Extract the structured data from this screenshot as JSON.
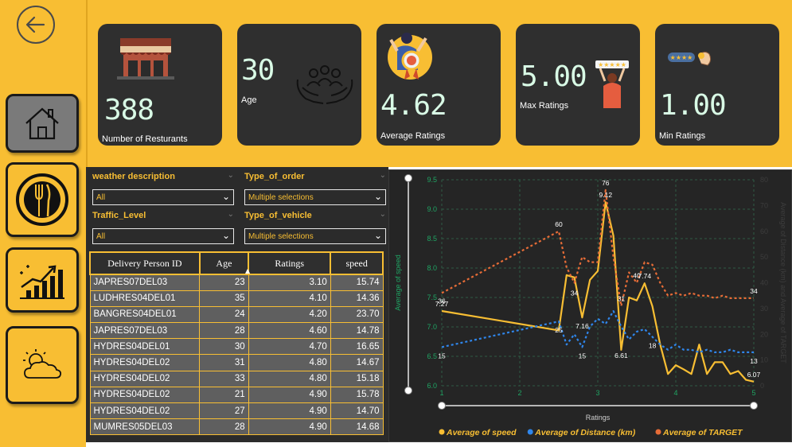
{
  "colors": {
    "accent": "#F8BE33",
    "card": "#2f2f2f",
    "speed": "#F8BE33",
    "distance": "#2F86EB",
    "target": "#E66C37"
  },
  "nav": {
    "icons": [
      "back-arrow-icon",
      "home-icon",
      "plate-fork-knife-icon",
      "growth-chart-icon",
      "weather-icon"
    ]
  },
  "kpis": {
    "restaurants": {
      "value": "388",
      "label": "Number of Resturants"
    },
    "age": {
      "value": "30",
      "label": "Age"
    },
    "avg_ratings": {
      "value": "4.62",
      "label": "Average Ratings"
    },
    "max_ratings": {
      "value": "5.00",
      "label": "Max Ratings"
    },
    "min_ratings": {
      "value": "1.00",
      "label": "Min Ratings"
    }
  },
  "filters": {
    "weather": {
      "title": "weather description",
      "value": "All"
    },
    "order": {
      "title": "Type_of_order",
      "value": "Multiple selections"
    },
    "traffic": {
      "title": "Traffic_Level",
      "value": "All"
    },
    "vehicle": {
      "title": "Type_of_vehicle",
      "value": "Multiple selections"
    }
  },
  "table": {
    "columns": [
      "Delivery Person ID",
      "Age",
      "Ratings",
      "speed"
    ],
    "rows": [
      [
        "JAPRES07DEL03",
        "23",
        "3.10",
        "15.74"
      ],
      [
        "LUDHRES04DEL01",
        "35",
        "4.10",
        "14.36"
      ],
      [
        "BANGRES04DEL01",
        "24",
        "4.20",
        "23.70"
      ],
      [
        "JAPRES07DEL03",
        "28",
        "4.60",
        "14.78"
      ],
      [
        "HYDRES04DEL01",
        "30",
        "4.70",
        "16.65"
      ],
      [
        "HYDRES04DEL02",
        "31",
        "4.80",
        "14.67"
      ],
      [
        "HYDRES04DEL02",
        "33",
        "4.80",
        "15.18"
      ],
      [
        "HYDRES04DEL02",
        "21",
        "4.90",
        "15.78"
      ],
      [
        "HYDRES04DEL02",
        "27",
        "4.90",
        "14.70"
      ],
      [
        "MUMRES05DEL03",
        "28",
        "4.90",
        "14.68"
      ]
    ]
  },
  "chart_data": {
    "type": "line",
    "xlabel": "Ratings",
    "ylabel": "Average of speed",
    "y2label": "Average of Distance (km) and Average of TARGET",
    "xlim": [
      1,
      5
    ],
    "ylim": [
      6.0,
      9.5
    ],
    "y2lim": [
      0,
      80
    ],
    "xticks": [
      "1",
      "2",
      "3",
      "4",
      "5"
    ],
    "yticks": [
      "6.0",
      "6.5",
      "7.0",
      "7.5",
      "8.0",
      "8.5",
      "9.0",
      "9.5"
    ],
    "y2ticks": [
      "0",
      "10",
      "20",
      "30",
      "40",
      "50",
      "60",
      "70",
      "80"
    ],
    "legend_position": "bottom",
    "series": [
      {
        "name": "Average of speed",
        "axis": "left",
        "style": "solid",
        "x": [
          1.0,
          2.5,
          2.6,
          2.7,
          2.8,
          2.9,
          3.0,
          3.1,
          3.2,
          3.3,
          3.4,
          3.5,
          3.6,
          3.7,
          3.8,
          3.9,
          4.0,
          4.1,
          4.2,
          4.3,
          4.4,
          4.5,
          4.6,
          4.7,
          4.8,
          4.9,
          5.0
        ],
        "y": [
          7.27,
          6.94,
          7.88,
          7.84,
          7.16,
          7.8,
          7.95,
          9.12,
          8.55,
          6.61,
          7.5,
          7.45,
          7.74,
          7.35,
          6.7,
          6.2,
          6.35,
          6.28,
          6.2,
          6.7,
          6.2,
          6.4,
          6.4,
          6.2,
          6.25,
          6.1,
          6.07
        ]
      },
      {
        "name": "Average of Distance (km)",
        "axis": "right",
        "style": "dotted",
        "x": [
          1.0,
          2.5,
          2.6,
          2.7,
          2.8,
          2.9,
          3.0,
          3.1,
          3.2,
          3.3,
          3.4,
          3.5,
          3.6,
          3.7,
          3.8,
          3.9,
          4.0,
          4.1,
          4.2,
          4.3,
          4.4,
          4.5,
          4.6,
          4.7,
          4.8,
          4.9,
          5.0
        ],
        "y": [
          15,
          25,
          16,
          20,
          15,
          23,
          26,
          24,
          29,
          23,
          18,
          21,
          22,
          19,
          16,
          14,
          16,
          14,
          14,
          13,
          14,
          13,
          13,
          14,
          13,
          13,
          13
        ]
      },
      {
        "name": "Average of TARGET",
        "axis": "right",
        "style": "dotted",
        "x": [
          1.0,
          2.5,
          2.6,
          2.7,
          2.8,
          2.9,
          3.0,
          3.1,
          3.2,
          3.3,
          3.4,
          3.5,
          3.6,
          3.7,
          3.8,
          3.9,
          4.0,
          4.1,
          4.2,
          4.3,
          4.4,
          4.5,
          4.6,
          4.7,
          4.8,
          4.9,
          5.0
        ],
        "y": [
          36,
          60,
          46,
          40,
          50,
          48,
          48,
          76,
          50,
          31,
          44,
          40,
          48,
          47,
          40,
          35,
          36,
          35,
          36,
          35,
          35,
          34,
          35,
          34,
          34,
          34,
          34
        ]
      }
    ],
    "data_labels": [
      {
        "series": 0,
        "index": 0,
        "text": "7.27"
      },
      {
        "series": 0,
        "index": 7,
        "text": "9.12"
      },
      {
        "series": 0,
        "index": 4,
        "text": "7.16"
      },
      {
        "series": 0,
        "index": 12,
        "text": "7.74"
      },
      {
        "series": 0,
        "index": 9,
        "text": "6.61"
      },
      {
        "series": 0,
        "index": 26,
        "text": "6.07"
      },
      {
        "series": 1,
        "index": 0,
        "text": "15"
      },
      {
        "series": 1,
        "index": 1,
        "text": "25"
      },
      {
        "series": 1,
        "index": 4,
        "text": "15"
      },
      {
        "series": 1,
        "index": 13,
        "text": "18"
      },
      {
        "series": 1,
        "index": 26,
        "text": "13"
      },
      {
        "series": 2,
        "index": 0,
        "text": "36"
      },
      {
        "series": 2,
        "index": 1,
        "text": "60"
      },
      {
        "series": 2,
        "index": 3,
        "text": "34"
      },
      {
        "series": 2,
        "index": 7,
        "text": "76"
      },
      {
        "series": 2,
        "index": 9,
        "text": "31"
      },
      {
        "series": 2,
        "index": 11,
        "text": "40"
      },
      {
        "series": 2,
        "index": 26,
        "text": "34"
      }
    ]
  }
}
